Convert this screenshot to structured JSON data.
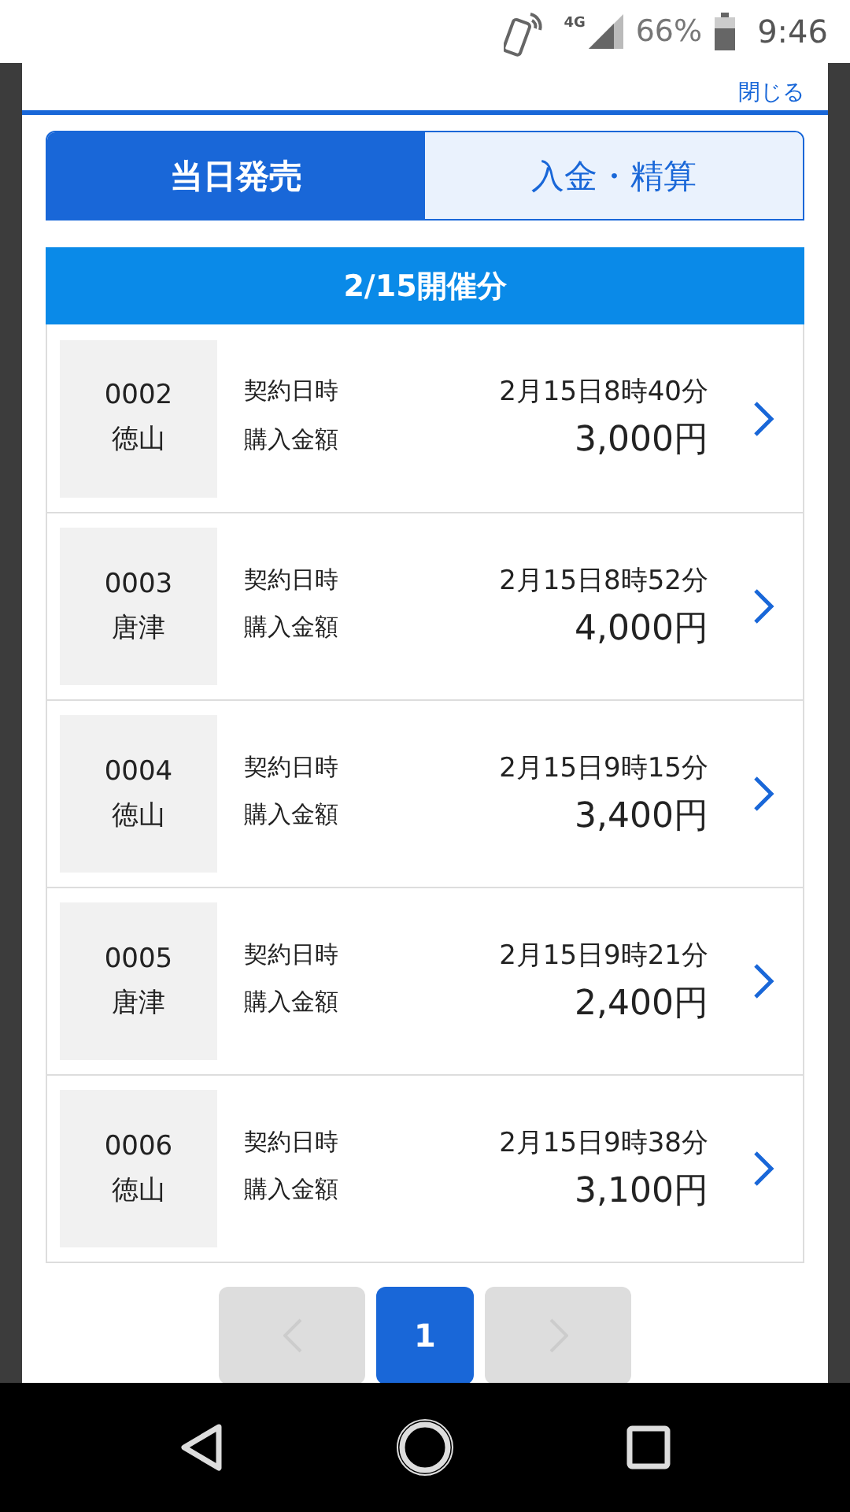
{
  "status_bar": {
    "network": "4G",
    "battery": "66%",
    "time": "9:46"
  },
  "modal": {
    "close": "閉じる"
  },
  "tabs": [
    {
      "label": "当日発売",
      "selected": true
    },
    {
      "label": "入金・精算",
      "selected": false
    }
  ],
  "section": {
    "title": "2/15開催分"
  },
  "records": [
    {
      "number": "0002",
      "venue": "徳山",
      "date_label": "契約日時",
      "date": "2月15日8時40分",
      "amount_label": "購入金額",
      "amount": "3,000円"
    },
    {
      "number": "0003",
      "venue": "唐津",
      "date_label": "契約日時",
      "date": "2月15日8時52分",
      "amount_label": "購入金額",
      "amount": "4,000円"
    },
    {
      "number": "0004",
      "venue": "徳山",
      "date_label": "契約日時",
      "date": "2月15日9時15分",
      "amount_label": "購入金額",
      "amount": "3,400円"
    },
    {
      "number": "0005",
      "venue": "唐津",
      "date_label": "契約日時",
      "date": "2月15日9時21分",
      "amount_label": "購入金額",
      "amount": "2,400円"
    },
    {
      "number": "0006",
      "venue": "徳山",
      "date_label": "契約日時",
      "date": "2月15日9時38分",
      "amount_label": "購入金額",
      "amount": "3,100円"
    }
  ],
  "pager": {
    "previous": {
      "disabled": true
    },
    "pages": [
      {
        "label": "1",
        "selected": true
      }
    ],
    "next": {
      "disabled": true
    }
  }
}
